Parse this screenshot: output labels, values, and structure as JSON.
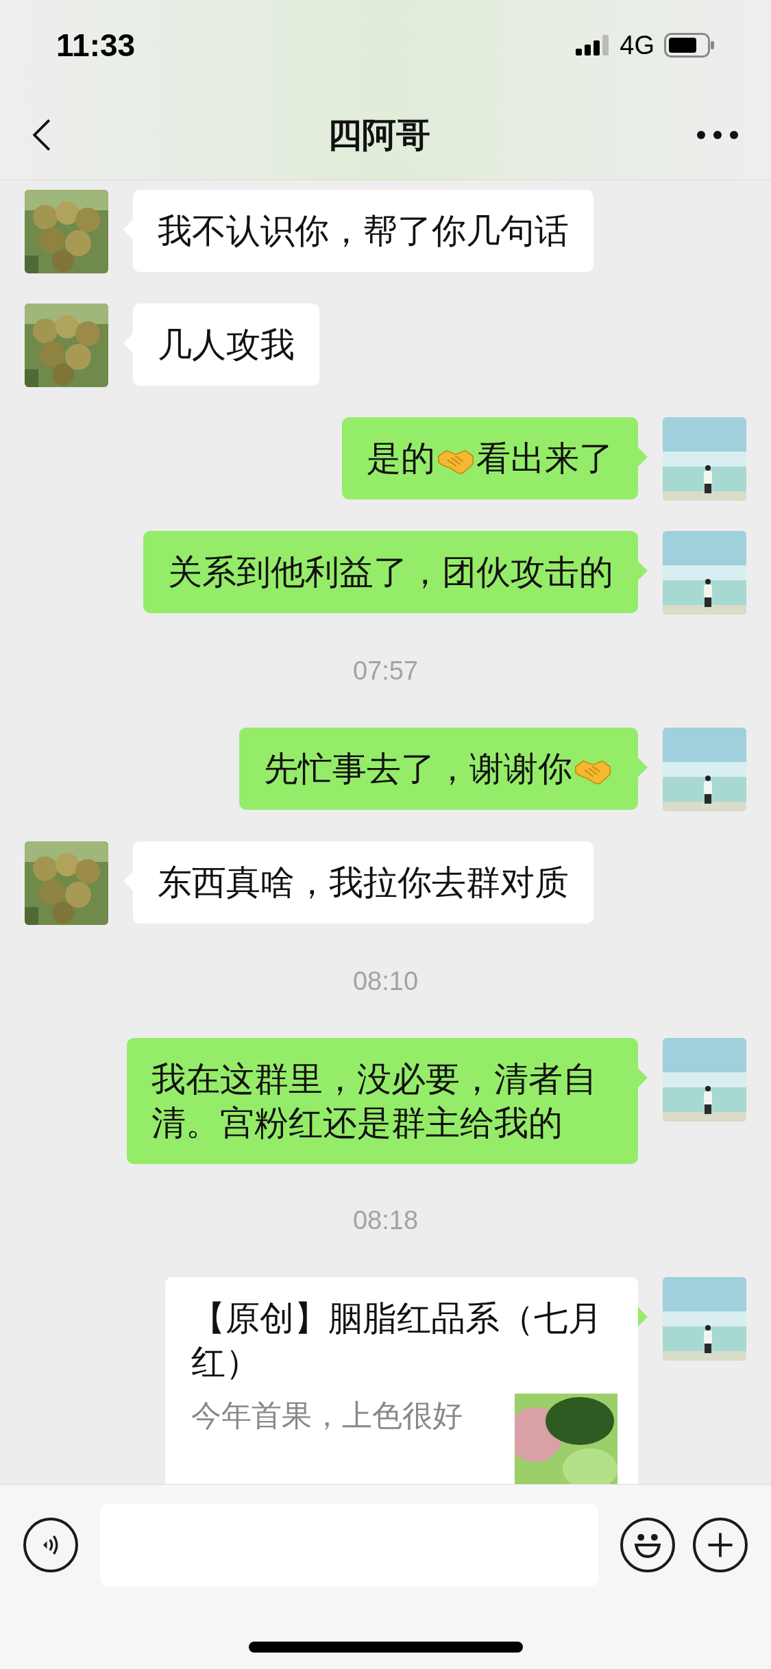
{
  "status_bar": {
    "time": "11:33",
    "network": "4G"
  },
  "nav": {
    "title": "四阿哥"
  },
  "messages": [
    {
      "kind": "text",
      "outgoing": false,
      "parts": [
        {
          "kind": "text",
          "text": "我不认识你，帮了你几句话"
        }
      ]
    },
    {
      "kind": "text",
      "outgoing": false,
      "parts": [
        {
          "kind": "text",
          "text": "几人攻我"
        }
      ]
    },
    {
      "kind": "text",
      "outgoing": true,
      "parts": [
        {
          "kind": "text",
          "text": "是的"
        },
        {
          "kind": "handshake"
        },
        {
          "kind": "text",
          "text": "看出来了"
        }
      ]
    },
    {
      "kind": "text",
      "outgoing": true,
      "parts": [
        {
          "kind": "text",
          "text": "关系到他利益了，团伙攻击的"
        }
      ]
    },
    {
      "kind": "time",
      "text": "07:57"
    },
    {
      "kind": "text",
      "outgoing": true,
      "parts": [
        {
          "kind": "text",
          "text": "先忙事去了，谢谢你"
        },
        {
          "kind": "handshake"
        }
      ]
    },
    {
      "kind": "text",
      "outgoing": false,
      "parts": [
        {
          "kind": "text",
          "text": "东西真啥，我拉你去群对质"
        }
      ]
    },
    {
      "kind": "time",
      "text": "08:10"
    },
    {
      "kind": "text",
      "outgoing": true,
      "parts": [
        {
          "kind": "text",
          "text": "我在这群里，没必要，清者自清。宫粉红还是群主给我的"
        }
      ]
    },
    {
      "kind": "time",
      "text": "08:18"
    },
    {
      "kind": "link",
      "outgoing": true,
      "title": "【原创】胭脂红品系（七月红）",
      "description": "今年首果，上色很好"
    }
  ]
}
